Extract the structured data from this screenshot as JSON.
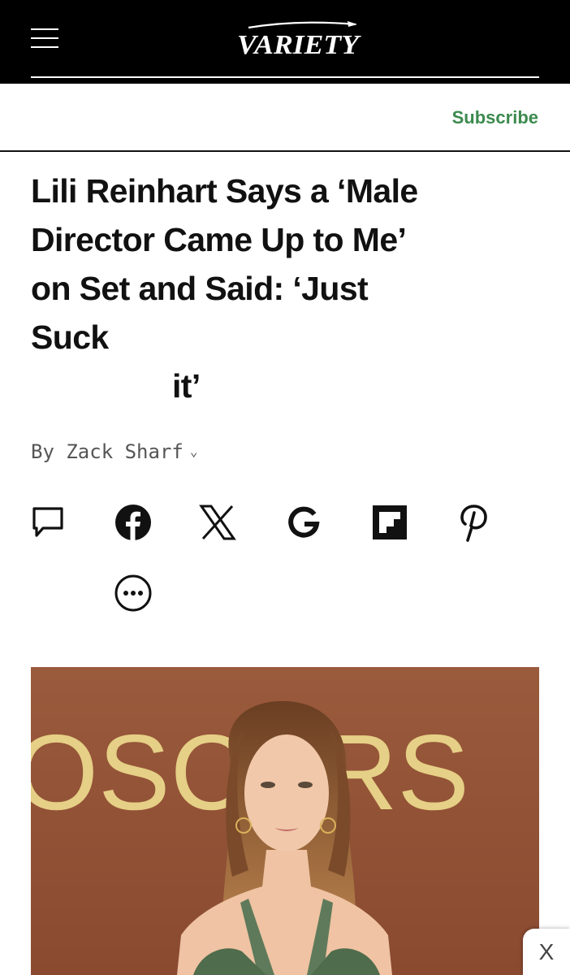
{
  "header": {
    "logo_text": "VARIETY",
    "menu_icon": "hamburger-menu-icon",
    "subscribe_label": "Subscribe",
    "accent_color": "#3c8a4f"
  },
  "article": {
    "headline_lines": [
      "Lili Reinhart Says a ‘Male",
      "Director Came Up to Me’",
      "on Set and Said: ‘Just",
      "Suck",
      "it’"
    ],
    "byline_prefix": "By",
    "author": "Zack Sharf"
  },
  "share": {
    "icons": [
      "comment-icon",
      "facebook-icon",
      "x-icon",
      "google-icon",
      "flipboard-icon",
      "pinterest-icon",
      "more-icon"
    ]
  },
  "hero_image": {
    "backdrop_text": "OSCARS",
    "description_icon": "photo"
  },
  "ad": {
    "close_label": "X"
  }
}
